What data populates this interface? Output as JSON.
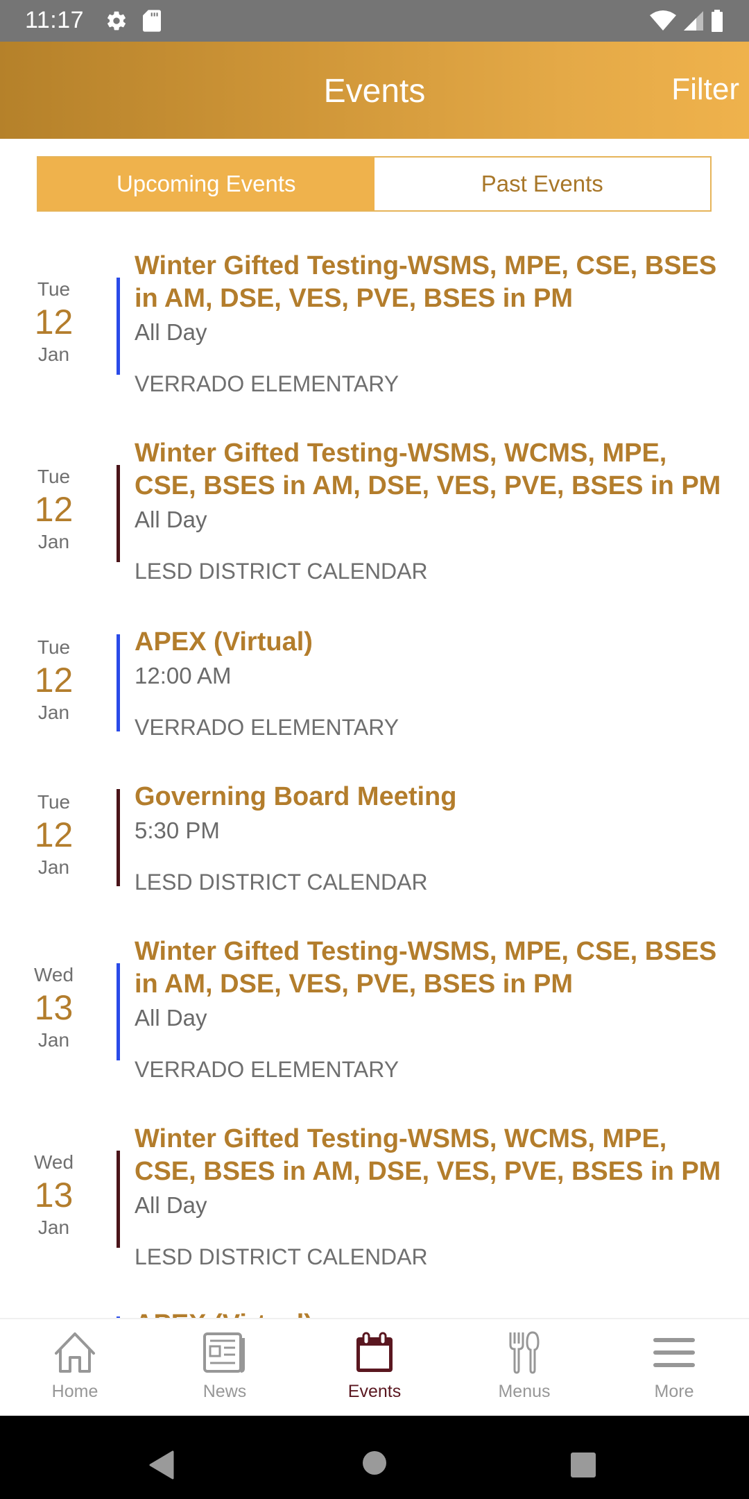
{
  "status_bar": {
    "time": "11:17",
    "left_icons": [
      "settings-icon",
      "sd-card-icon"
    ],
    "right_icons": [
      "wifi-icon",
      "signal-icon",
      "battery-icon"
    ]
  },
  "header": {
    "title": "Events",
    "filter_label": "Filter"
  },
  "tabs": [
    {
      "label": "Upcoming Events",
      "active": true
    },
    {
      "label": "Past Events",
      "active": false
    }
  ],
  "colors": {
    "brand_gold": "#efb24c",
    "title_gold": "#b37d2c",
    "verrado_accent": "#2a4be8",
    "district_accent": "#4a1419",
    "nav_active": "#5a1720"
  },
  "events": [
    {
      "dow": "Tue",
      "day": "12",
      "month": "Jan",
      "title": "Winter Gifted Testing-WSMS, MPE, CSE, BSES in AM, DSE, VES, PVE, BSES in PM",
      "time": "All Day",
      "calendar": "VERRADO ELEMENTARY",
      "accent": "#2a4be8"
    },
    {
      "dow": "Tue",
      "day": "12",
      "month": "Jan",
      "title": "Winter Gifted Testing-WSMS, WCMS, MPE, CSE, BSES in AM, DSE, VES, PVE, BSES in PM",
      "time": "All Day",
      "calendar": "LESD DISTRICT CALENDAR",
      "accent": "#4a1419"
    },
    {
      "dow": "Tue",
      "day": "12",
      "month": "Jan",
      "title": "APEX (Virtual)",
      "time": "12:00 AM",
      "calendar": "VERRADO ELEMENTARY",
      "accent": "#2a4be8"
    },
    {
      "dow": "Tue",
      "day": "12",
      "month": "Jan",
      "title": "Governing Board Meeting",
      "time": "5:30 PM",
      "calendar": "LESD DISTRICT CALENDAR",
      "accent": "#4a1419"
    },
    {
      "dow": "Wed",
      "day": "13",
      "month": "Jan",
      "title": "Winter Gifted Testing-WSMS, MPE, CSE, BSES in AM, DSE, VES, PVE, BSES in PM",
      "time": "All Day",
      "calendar": "VERRADO ELEMENTARY",
      "accent": "#2a4be8"
    },
    {
      "dow": "Wed",
      "day": "13",
      "month": "Jan",
      "title": "Winter Gifted Testing-WSMS, WCMS, MPE, CSE, BSES in AM, DSE, VES, PVE, BSES in PM",
      "time": "All Day",
      "calendar": "LESD DISTRICT CALENDAR",
      "accent": "#4a1419"
    },
    {
      "dow": "",
      "day": "",
      "month": "",
      "title": "APEX (Virtual)",
      "time": "",
      "calendar": "",
      "accent": "#2a4be8"
    }
  ],
  "bottom_nav": [
    {
      "label": "Home",
      "icon": "home-icon",
      "active": false
    },
    {
      "label": "News",
      "icon": "newspaper-icon",
      "active": false
    },
    {
      "label": "Events",
      "icon": "calendar-icon",
      "active": true
    },
    {
      "label": "Menus",
      "icon": "utensils-icon",
      "active": false
    },
    {
      "label": "More",
      "icon": "hamburger-menu-icon",
      "active": false
    }
  ],
  "system_nav": [
    "back-icon",
    "home-circle-icon",
    "recents-icon"
  ]
}
